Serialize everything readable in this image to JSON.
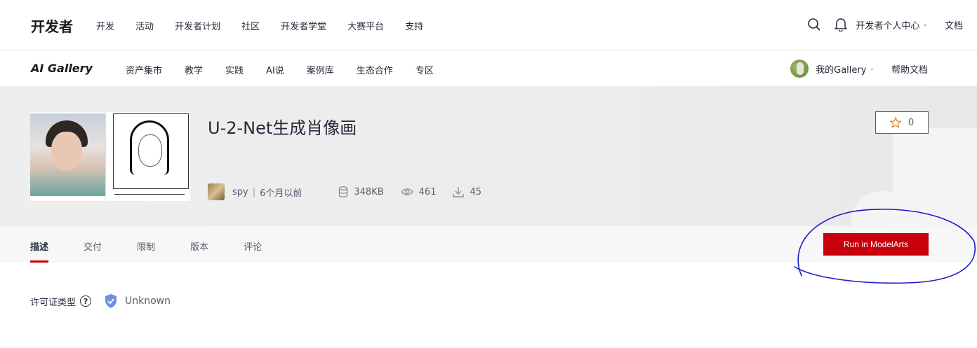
{
  "topnav": {
    "brand": "开发者",
    "menu": [
      "开发",
      "活动",
      "开发者计划",
      "社区",
      "开发者学堂",
      "大赛平台",
      "支持"
    ],
    "user_center": "开发者个人中心",
    "docs": "文档"
  },
  "subnav": {
    "logo": "AI Gallery",
    "menu": [
      "资产集市",
      "教学",
      "实践",
      "AI说",
      "案例库",
      "生态合作",
      "专区"
    ],
    "my_gallery": "我的Gallery",
    "help_docs": "帮助文档"
  },
  "asset": {
    "title": "U-2-Net生成肖像画",
    "author": "spy",
    "separator": "|",
    "time": "6个月以前",
    "size": "348KB",
    "views": "461",
    "downloads": "45",
    "stars": "0"
  },
  "tabs": [
    "描述",
    "交付",
    "限制",
    "版本",
    "评论"
  ],
  "run_button": "Run in ModelArts",
  "license": {
    "label": "许可证类型",
    "help": "?",
    "value": "Unknown"
  },
  "colors": {
    "accent": "#c7000b",
    "annotation": "#1a1acc"
  }
}
